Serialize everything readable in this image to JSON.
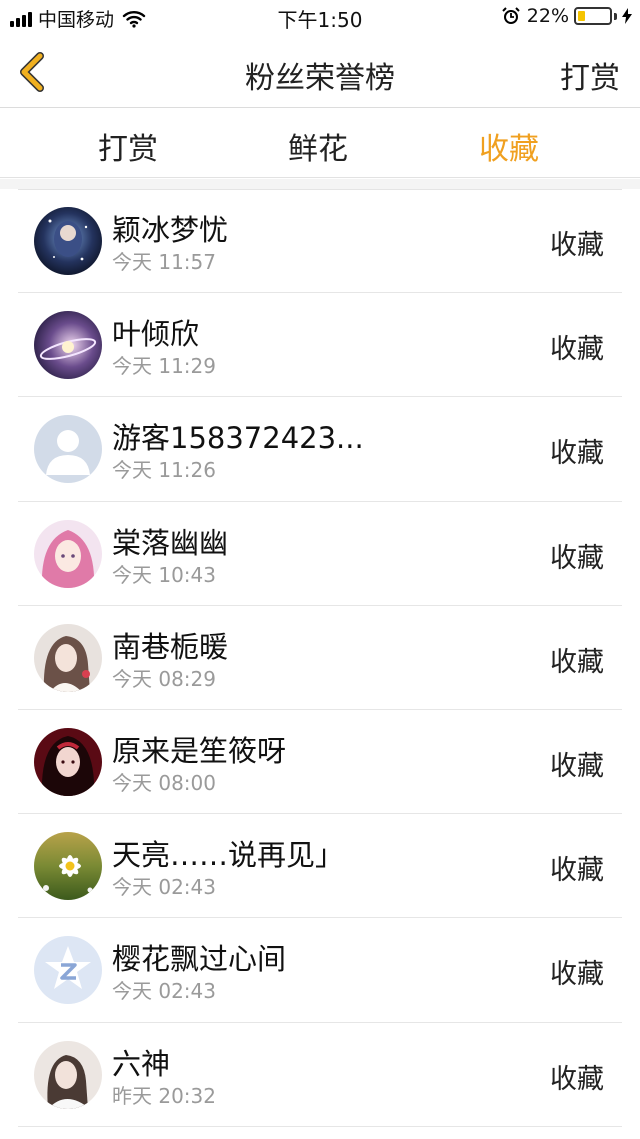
{
  "status_bar": {
    "carrier": "中国移动",
    "time": "下午1:50",
    "battery_percent": "22%",
    "battery_level": 0.22,
    "icons": [
      "signal-icon",
      "wifi-icon",
      "alarm-icon",
      "battery-icon",
      "charging-icon"
    ]
  },
  "nav": {
    "back_icon": "chevron-left-icon",
    "title": "粉丝荣誉榜",
    "action": "打赏"
  },
  "tabs": [
    {
      "label": "打赏",
      "active": false
    },
    {
      "label": "鲜花",
      "active": false
    },
    {
      "label": "收藏",
      "active": true
    }
  ],
  "colors": {
    "accent": "#f0a020",
    "back_icon": "#f0b020"
  },
  "fans": [
    {
      "name": "颖冰梦忧",
      "time": "今天 11:57",
      "label": "收藏"
    },
    {
      "name": "叶倾欣",
      "time": "今天 11:29",
      "label": "收藏"
    },
    {
      "name": "游客158372423...",
      "time": "今天 11:26",
      "label": "收藏"
    },
    {
      "name": "棠落幽幽",
      "time": "今天 10:43",
      "label": "收藏"
    },
    {
      "name": "南巷栀暖",
      "time": "今天 08:29",
      "label": "收藏"
    },
    {
      "name": "原来是笙筱呀",
      "time": "今天 08:00",
      "label": "收藏"
    },
    {
      "name": "天亮……说再见」",
      "time": "今天 02:43",
      "label": "收藏"
    },
    {
      "name": "樱花飘过心间",
      "time": "今天 02:43",
      "label": "收藏"
    },
    {
      "name": "六神",
      "time": "昨天 20:32",
      "label": "收藏"
    }
  ]
}
